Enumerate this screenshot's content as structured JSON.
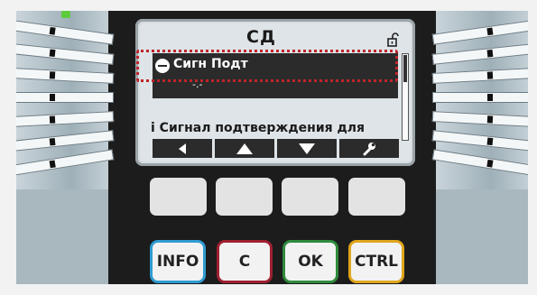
{
  "display": {
    "title": "СД",
    "item_label": "Сигн Подт",
    "item_value": "-.-",
    "info_text": "i Сигнал подтверждения для",
    "softkeys": [
      {
        "icon": "arrow-left-icon"
      },
      {
        "icon": "arrow-up-icon"
      },
      {
        "icon": "arrow-down-icon"
      },
      {
        "icon": "wrench-icon"
      }
    ]
  },
  "keys": {
    "info": "INFO",
    "c": "C",
    "ok": "OK",
    "ctrl": "CTRL"
  },
  "colors": {
    "highlight_box": "#c0242a",
    "info_key": "#2f9bd1",
    "c_key": "#9e2030",
    "ok_key": "#2f8a3c",
    "ctrl_key": "#e0a51c",
    "led": "#5ccc3c"
  }
}
